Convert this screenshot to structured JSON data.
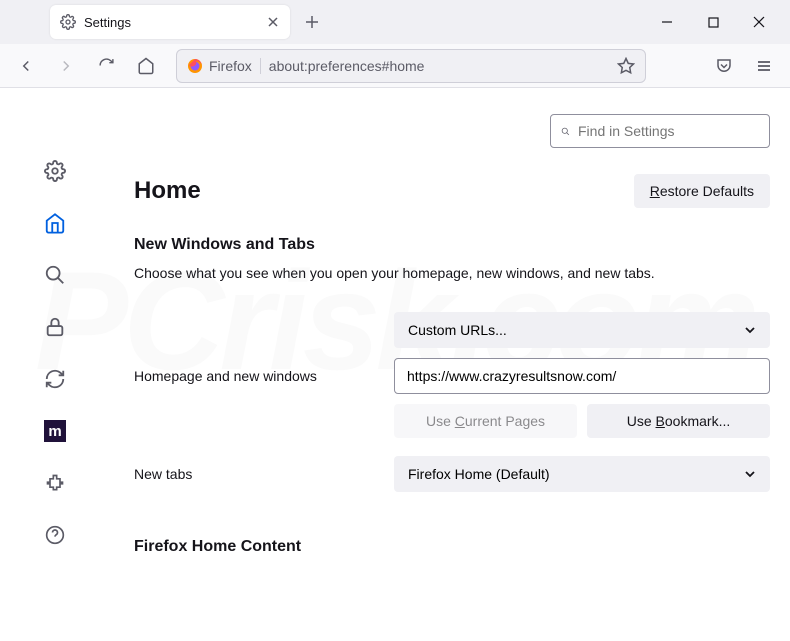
{
  "tab": {
    "title": "Settings"
  },
  "urlbar": {
    "identity": "Firefox",
    "url": "about:preferences#home"
  },
  "search": {
    "placeholder": "Find in Settings"
  },
  "page": {
    "title": "Home",
    "restore": "Restore Defaults"
  },
  "section1": {
    "title": "New Windows and Tabs",
    "desc": "Choose what you see when you open your homepage, new windows, and new tabs.",
    "homepage_label": "Homepage and new windows",
    "homepage_select": "Custom URLs...",
    "homepage_url": "https://www.crazyresultsnow.com/",
    "use_current": "Use Current Pages",
    "use_bookmark": "Use Bookmark...",
    "newtabs_label": "New tabs",
    "newtabs_select": "Firefox Home (Default)"
  },
  "section2": {
    "title": "Firefox Home Content"
  }
}
